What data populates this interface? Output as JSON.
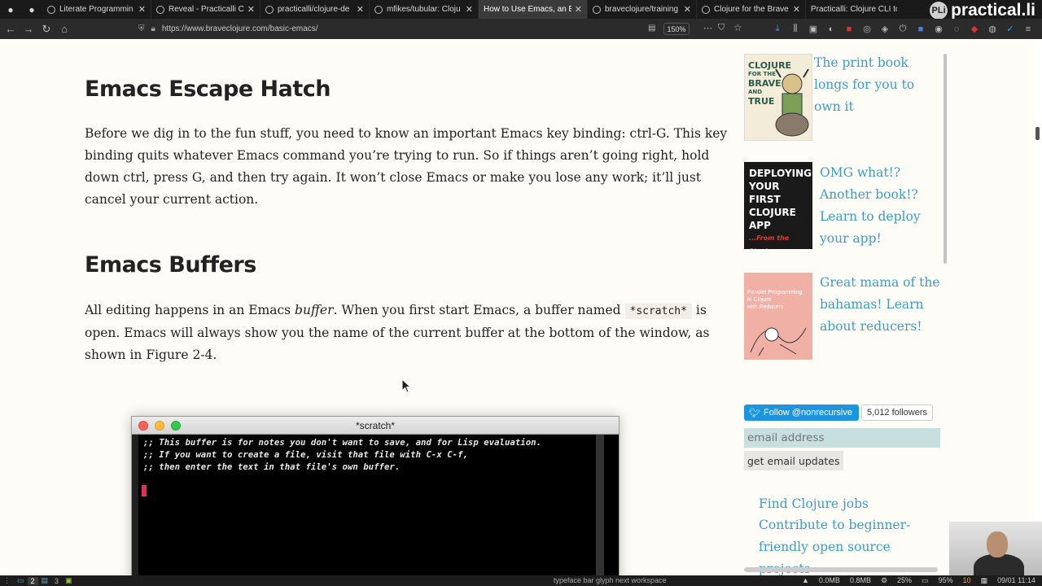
{
  "browser": {
    "tabs": [
      {
        "title": "Literate Programmin",
        "active": false
      },
      {
        "title": "Reveal - Practicalli Cl",
        "active": false
      },
      {
        "title": "practicalli/clojure-de",
        "active": false
      },
      {
        "title": "mfikes/tubular: Cloju",
        "active": false
      },
      {
        "title": "How to Use Emacs, an E",
        "active": true
      },
      {
        "title": "braveclojure/training",
        "active": false
      },
      {
        "title": "Clojure for the Brave",
        "active": false
      },
      {
        "title": "Practicalli: Clojure CLI to",
        "active": false
      }
    ],
    "logo_text": "practical.li",
    "logo_badge": "PLi",
    "url": "https://www.braveclojure.com/basic-emacs/",
    "zoom": "150%"
  },
  "article": {
    "section1_heading": "Emacs Escape Hatch",
    "section1_para": "Before we dig in to the fun stuff, you need to know an important Emacs key binding: ctrl-G. This key binding quits whatever Emacs command you’re trying to run. So if things aren’t going right, hold down ctrl, press G, and then try again. It won’t close Emacs or make you lose any work; it’ll just cancel your current action.",
    "section2_heading": "Emacs Buffers",
    "section2_para_a": "All editing happens in an Emacs ",
    "section2_para_em": "buffer",
    "section2_para_b": ". When you first start Emacs, a buffer named ",
    "section2_para_code": "*scratch*",
    "section2_para_c": " is open. Emacs will always show you the name of the current buffer at the bottom of the window, as shown in Figure 2-4."
  },
  "emacs_window": {
    "title": "*scratch*",
    "lines": [
      ";; This buffer is for notes you don't want to save, and for Lisp evaluation.",
      ";; If you want to create a file, visit that file with C-x C-f,",
      ";; then enter the text in that file's own buffer."
    ]
  },
  "sidebar": {
    "promos": [
      {
        "text": "The print book longs for you to own it",
        "cover_lines": [
          "CLOJURE",
          "FOR THE",
          "BRAVE",
          "AND",
          "TRUE"
        ]
      },
      {
        "text": "OMG what!? Another book!? Learn to deploy your app!",
        "cover_lines": [
          "DEPLOYING",
          "YOUR FIRST",
          "CLOJURE APP",
          "...From the Shadows"
        ]
      },
      {
        "text": "Great mama of the bahamas! Learn about reducers!",
        "cover_lines": [
          "Parallel Programming",
          "in Clojure",
          "with Reducers"
        ]
      }
    ],
    "twitter_label": "Follow @nonrecursive",
    "followers": "5,012 followers",
    "email_placeholder": "email address",
    "email_button": "get email updates",
    "links": [
      "Find Clojure jobs",
      "Contribute to beginner-friendly open source projects"
    ]
  },
  "statusbar": {
    "workspaces": [
      "1",
      "2",
      "3"
    ],
    "hint": "typeface  bar  glyph  next  workspace",
    "items": [
      "0.0MB",
      "0.8MB",
      "25%",
      "95%",
      "10",
      "09/01 11:14"
    ]
  },
  "colors": {
    "link": "#3d9dc2",
    "page_bg": "#fdfcf6",
    "twitter": "#1b95e0",
    "email_input_bg": "#c7dfdf"
  }
}
